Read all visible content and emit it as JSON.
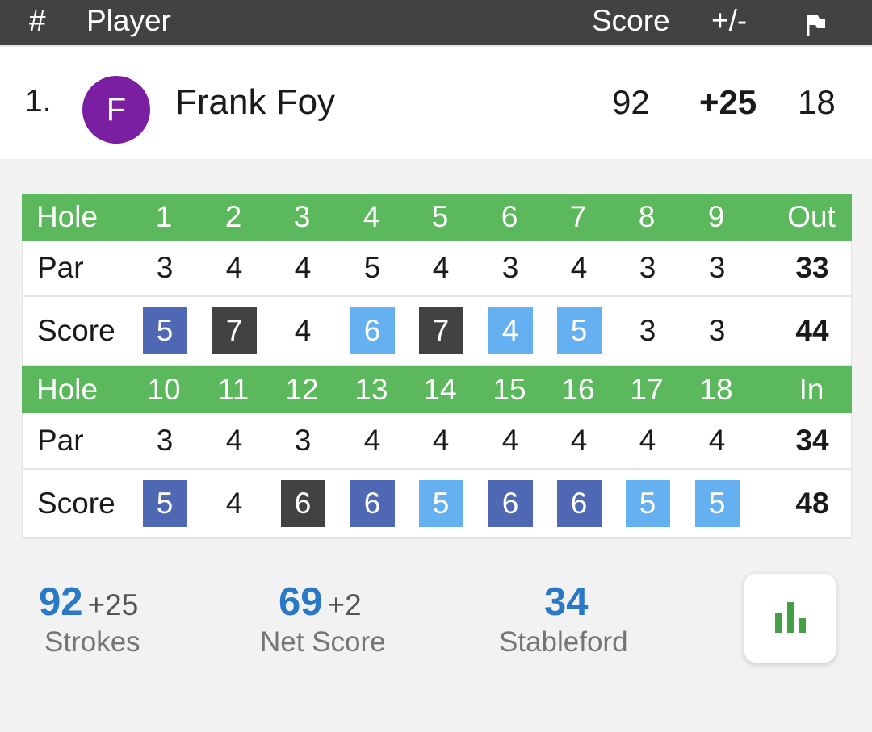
{
  "header": {
    "hash": "#",
    "player": "Player",
    "score": "Score",
    "plus_minus": "+/-",
    "flag_icon": "flag-icon"
  },
  "player": {
    "position": "1.",
    "initial": "F",
    "name": "Frank Foy",
    "score": "92",
    "plus_minus": "+25",
    "thru": "18",
    "avatar_color": "#7b1fa2"
  },
  "front": {
    "hole_label": "Hole",
    "total_label": "Out",
    "holes": [
      "1",
      "2",
      "3",
      "4",
      "5",
      "6",
      "7",
      "8",
      "9"
    ],
    "par_label": "Par",
    "par": [
      "3",
      "4",
      "4",
      "5",
      "4",
      "3",
      "4",
      "3",
      "3"
    ],
    "par_total": "33",
    "score_label": "Score",
    "scores": [
      "5",
      "7",
      "4",
      "6",
      "7",
      "4",
      "5",
      "3",
      "3"
    ],
    "score_total": "44",
    "score_styles": [
      "bogey",
      "double",
      "none",
      "birdie",
      "double",
      "birdie",
      "birdie",
      "none",
      "none"
    ]
  },
  "back": {
    "hole_label": "Hole",
    "total_label": "In",
    "holes": [
      "10",
      "11",
      "12",
      "13",
      "14",
      "15",
      "16",
      "17",
      "18"
    ],
    "par_label": "Par",
    "par": [
      "3",
      "4",
      "3",
      "4",
      "4",
      "4",
      "4",
      "4",
      "4"
    ],
    "par_total": "34",
    "score_label": "Score",
    "scores": [
      "5",
      "4",
      "6",
      "6",
      "5",
      "6",
      "6",
      "5",
      "5"
    ],
    "score_total": "48",
    "score_styles": [
      "bogey",
      "none",
      "double",
      "bogey",
      "birdie",
      "bogey",
      "bogey",
      "birdie",
      "birdie"
    ]
  },
  "colors": {
    "header_bg": "#424242",
    "hole_row": "#5cb85c",
    "bogey": "#4f68b3",
    "double": "#424242",
    "birdie": "#64b0f0",
    "stat_blue": "#2979c6",
    "chart_green": "#43a047"
  },
  "summary": {
    "strokes": {
      "value": "92",
      "diff": "+25",
      "label": "Strokes"
    },
    "net": {
      "value": "69",
      "diff": "+2",
      "label": "Net Score"
    },
    "stableford": {
      "value": "34",
      "label": "Stableford"
    },
    "chart_icon": "bar-chart-icon"
  }
}
